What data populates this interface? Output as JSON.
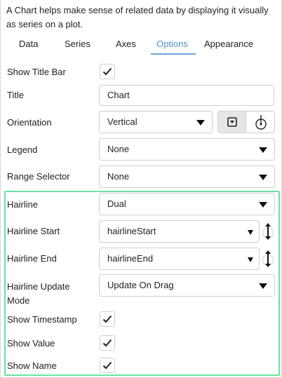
{
  "description": "A Chart helps make sense of related data by displaying it visually as series on a plot.",
  "tabs": [
    {
      "label": "Data"
    },
    {
      "label": "Series"
    },
    {
      "label": "Axes"
    },
    {
      "label": "Options"
    },
    {
      "label": "Appearance"
    }
  ],
  "active_tab": "Options",
  "fields": {
    "show_title_bar": {
      "label": "Show Title Bar",
      "checked": true
    },
    "title": {
      "label": "Title",
      "value": "Chart"
    },
    "orientation": {
      "label": "Orientation",
      "value": "Vertical"
    },
    "legend": {
      "label": "Legend",
      "value": "None"
    },
    "range_selector": {
      "label": "Range Selector",
      "value": "None"
    },
    "hairline": {
      "label": "Hairline",
      "value": "Dual"
    },
    "hairline_start": {
      "label": "Hairline Start",
      "value": "hairlineStart"
    },
    "hairline_end": {
      "label": "Hairline End",
      "value": "hairlineEnd"
    },
    "hairline_update_mode": {
      "label": "Hairline Update Mode",
      "value": "Update On Drag"
    },
    "show_timestamp": {
      "label": "Show Timestamp",
      "checked": true
    },
    "show_value": {
      "label": "Show Value",
      "checked": true
    },
    "show_name": {
      "label": "Show Name",
      "checked": true
    }
  },
  "icons": {
    "checkmark": "checkmark-icon",
    "orientation_left": "collapse-down-icon",
    "orientation_right": "rotate-icon",
    "binding": "vertical-arrows-icon"
  },
  "colors": {
    "active_tab": "#4a90c8",
    "group_highlight": "#69e3a3"
  }
}
